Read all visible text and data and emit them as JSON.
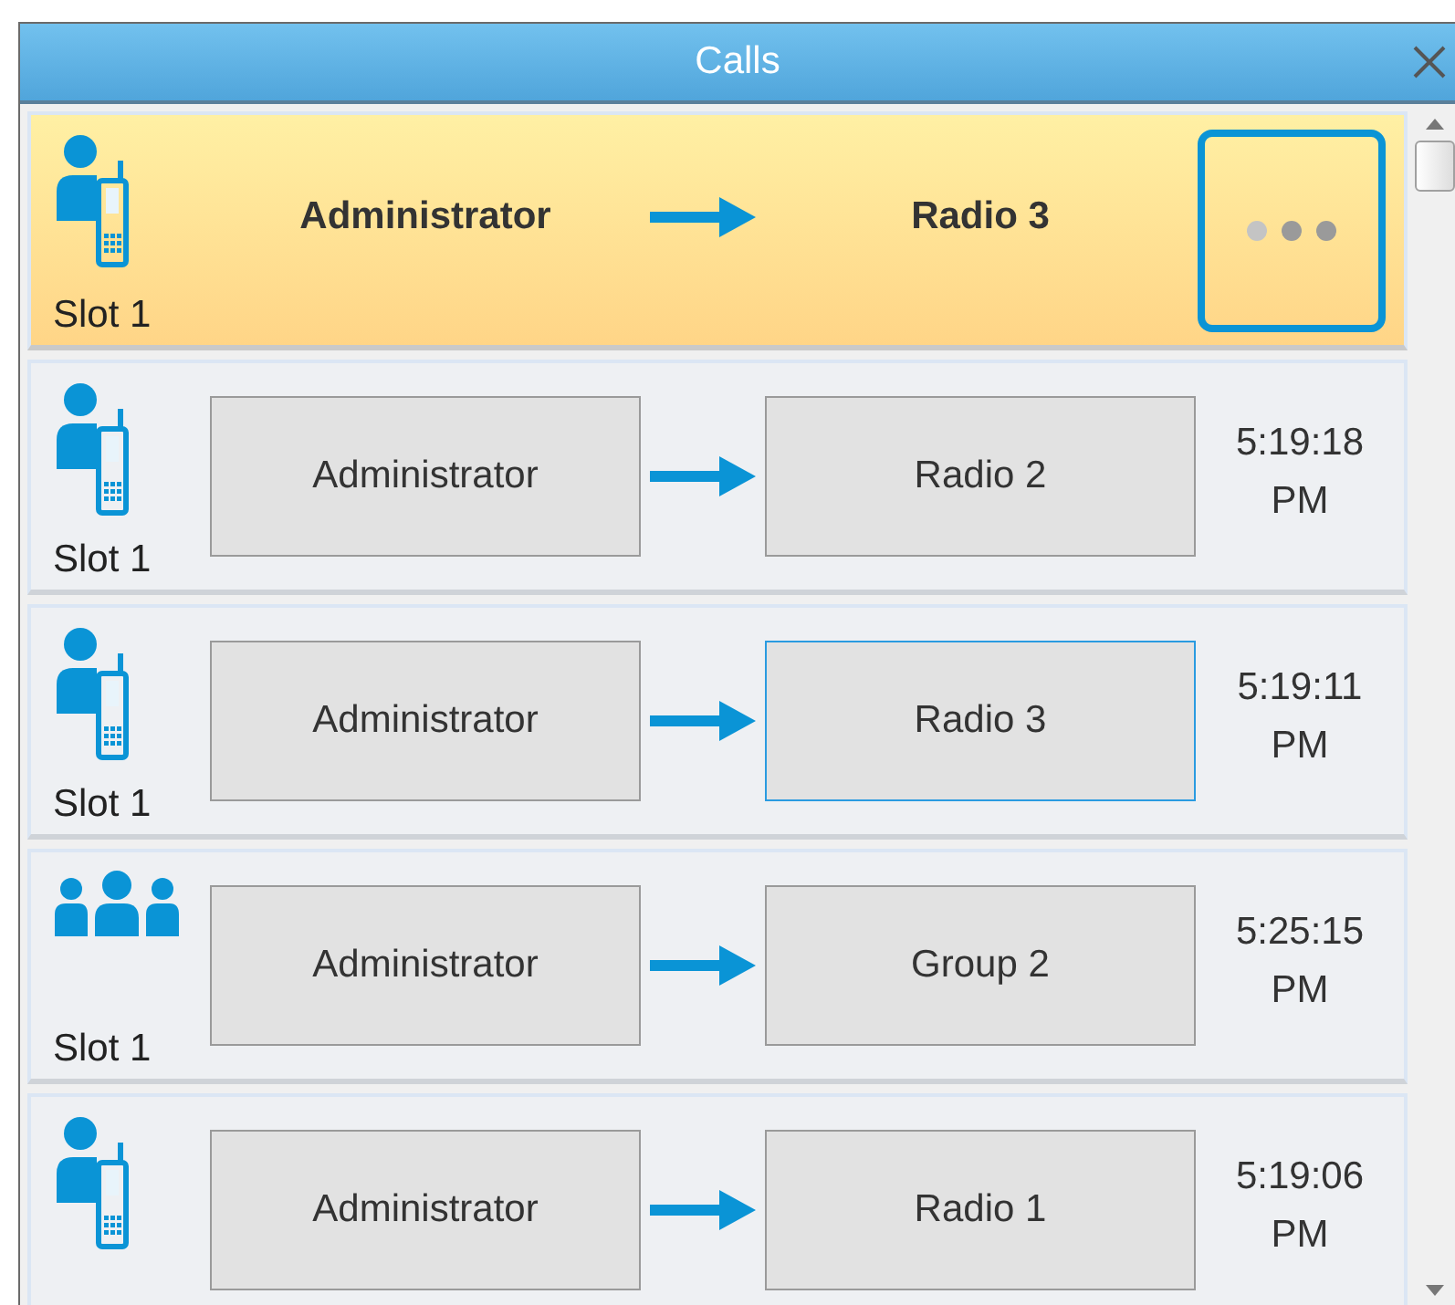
{
  "window": {
    "title": "Calls"
  },
  "calls": [
    {
      "kind": "person_radio",
      "selected": true,
      "slot": "Slot 1",
      "source": "Administrator",
      "target": "Radio 3",
      "target_focused": false
    },
    {
      "kind": "person_radio",
      "selected": false,
      "slot": "Slot 1",
      "source": "Administrator",
      "target": "Radio 2",
      "target_focused": false,
      "time": [
        "5:19:18",
        "PM"
      ]
    },
    {
      "kind": "person_radio",
      "selected": false,
      "slot": "Slot 1",
      "source": "Administrator",
      "target": "Radio 3",
      "target_focused": true,
      "time": [
        "5:19:11",
        "PM"
      ]
    },
    {
      "kind": "group",
      "selected": false,
      "slot": "Slot 1",
      "source": "Administrator",
      "target": "Group 2",
      "target_focused": false,
      "time": [
        "5:25:15",
        "PM"
      ]
    },
    {
      "kind": "person_radio",
      "selected": false,
      "source": "Administrator",
      "target": "Radio 1",
      "target_focused": false,
      "time": [
        "5:19:06",
        "PM"
      ]
    }
  ]
}
